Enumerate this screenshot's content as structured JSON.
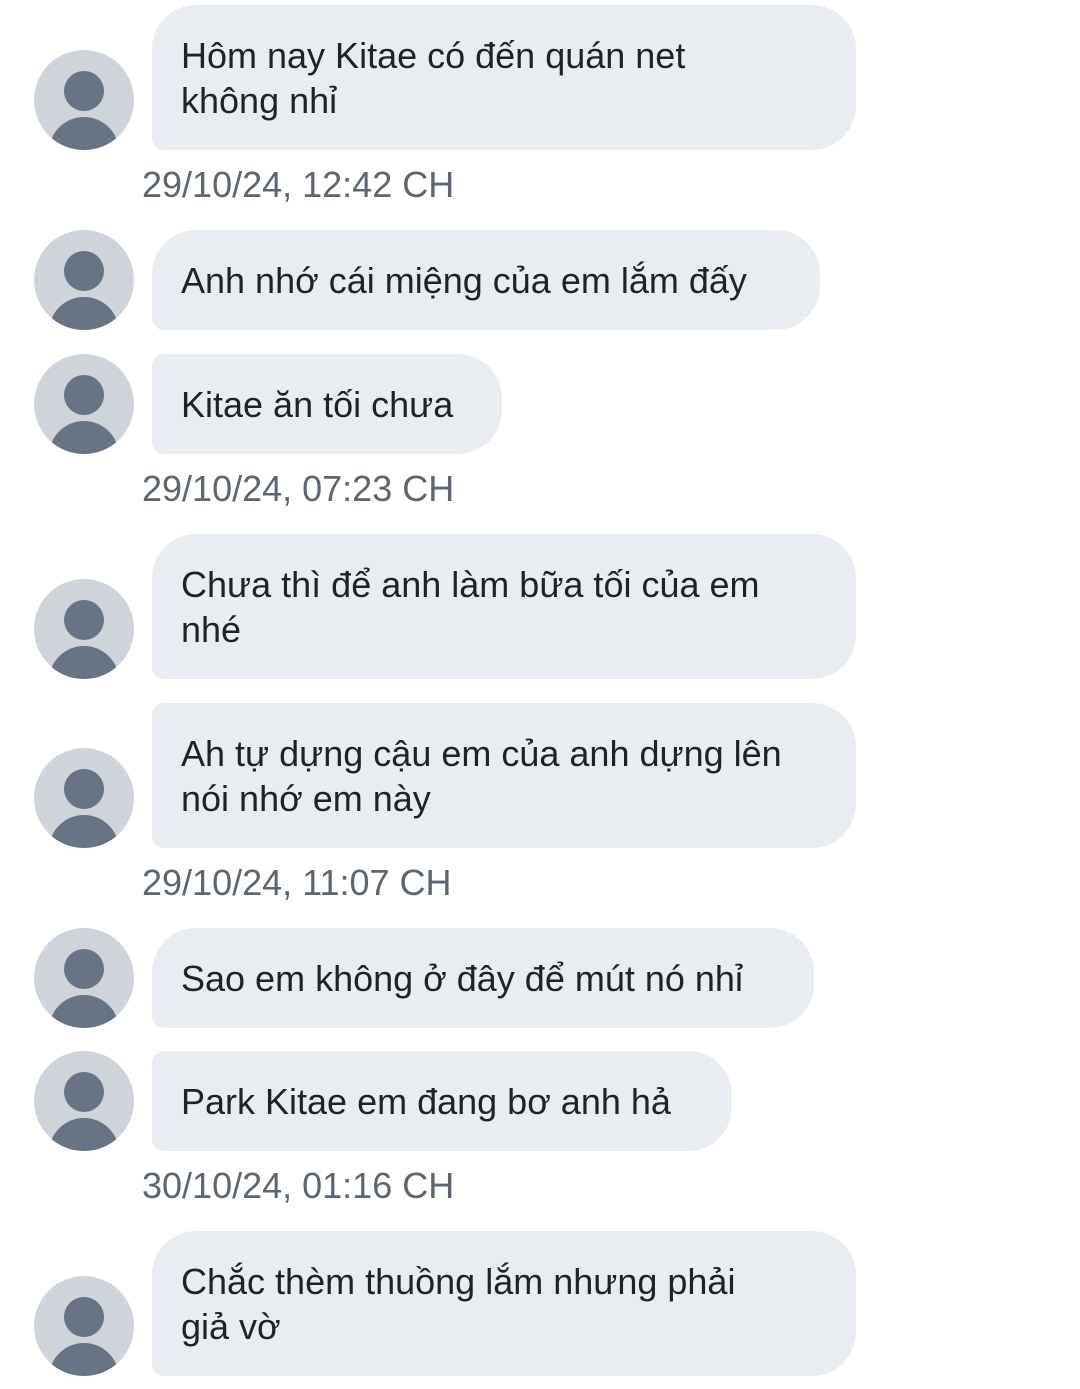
{
  "messages": [
    {
      "text": "Hôm nay Kitae có đến quán net\nkhông nhỉ"
    },
    {
      "text": "Anh nhớ cái miệng của em lắm đấy"
    },
    {
      "text": "Kitae ăn tối chưa"
    },
    {
      "text": "Chưa thì để anh làm bữa tối của em\nnhé"
    },
    {
      "text": "Ah tự dựng cậu em của anh dựng lên\nnói nhớ em này"
    },
    {
      "text": "Sao em không ở đây để mút nó nhỉ"
    },
    {
      "text": "Park Kitae em đang bơ anh hả"
    },
    {
      "text": "Chắc thèm thuồng lắm nhưng phải\ngiả vờ"
    }
  ],
  "timestamps": [
    "29/10/24, 12:42 CH",
    "29/10/24, 07:23 CH",
    "29/10/24, 11:07 CH",
    "30/10/24, 01:16 CH"
  ],
  "colors": {
    "bubble": "#e9ecf0",
    "avatar_bg": "#ced4da",
    "avatar_fg": "#687483",
    "text": "#1f2329",
    "timestamp": "#5c6571"
  }
}
